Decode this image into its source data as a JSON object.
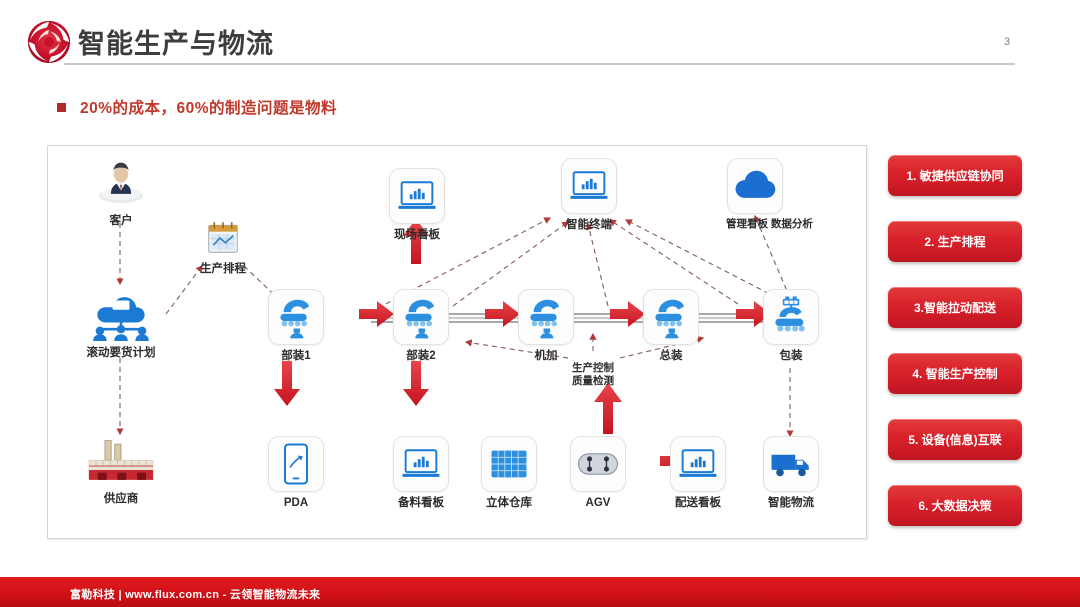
{
  "header": {
    "title": "智能生产与物流",
    "logo_icon": "red-spiral-logo",
    "page_number": "3"
  },
  "bullet": {
    "text": "20%的成本，60%的制造问题是物料",
    "marker_color": "#b02a2a",
    "text_color": "#c0392b"
  },
  "diagram": {
    "nodes": [
      {
        "id": "customer",
        "label": "客户",
        "icon": "businessman-icon"
      },
      {
        "id": "schedule",
        "label": "生产排程",
        "icon": "calendar-icon"
      },
      {
        "id": "rolling-plan",
        "label": "滚动要货计划",
        "icon": "cloud-people-icon"
      },
      {
        "id": "supplier",
        "label": "供应商",
        "icon": "factory-icon"
      },
      {
        "id": "onsite-board",
        "label": "现场看板",
        "icon": "laptop-chart-icon"
      },
      {
        "id": "smart-terminal",
        "label": "智能终端",
        "icon": "laptop-chart-icon"
      },
      {
        "id": "mgmt-board",
        "label": "管理看板 数据分析",
        "icon": "cloud-icon"
      },
      {
        "id": "subassembly-1",
        "label": "部装1",
        "icon": "robot-arm-icon"
      },
      {
        "id": "subassembly-2",
        "label": "部装2",
        "icon": "robot-arm-icon"
      },
      {
        "id": "machining",
        "label": "机加",
        "icon": "robot-arm-icon"
      },
      {
        "id": "final-assembly",
        "label": "总装",
        "icon": "robot-arm-icon"
      },
      {
        "id": "packaging",
        "label": "包装",
        "icon": "packing-robot-icon"
      },
      {
        "id": "pda",
        "label": "PDA",
        "icon": "mobile-phone-icon"
      },
      {
        "id": "prep-board",
        "label": "备料看板",
        "icon": "laptop-chart-icon"
      },
      {
        "id": "warehouse",
        "label": "立体仓库",
        "icon": "rack-warehouse-icon"
      },
      {
        "id": "agv",
        "label": "AGV",
        "icon": "agv-cart-icon"
      },
      {
        "id": "delivery-board",
        "label": "配送看板",
        "icon": "laptop-chart-icon"
      },
      {
        "id": "smart-logistics",
        "label": "智能物流",
        "icon": "truck-icon"
      }
    ],
    "free_labels": [
      {
        "id": "quality-control",
        "line1": "生产控制",
        "line2": "质量检测"
      }
    ],
    "arrow_color": "#d8232a",
    "dashed_color": "#7a5a5a",
    "icon_color": "#1a7ad4"
  },
  "right_rail": {
    "items": [
      {
        "id": "agile-supply-chain",
        "label": "1. 敏捷供应链协同"
      },
      {
        "id": "production-schedule",
        "label": "2. 生产排程"
      },
      {
        "id": "smart-pull-delivery",
        "label": "3.智能拉动配送"
      },
      {
        "id": "smart-prod-control",
        "label": "4. 智能生产控制"
      },
      {
        "id": "equipment-iot",
        "label": "5. 设备(信息)互联"
      },
      {
        "id": "big-data-decision",
        "label": "6. 大数据决策"
      }
    ],
    "color": "#d8202a"
  },
  "footer": {
    "text": "富勒科技 | www.flux.com.cn  -  云领智能物流未来",
    "band_color": "#cf1117"
  }
}
